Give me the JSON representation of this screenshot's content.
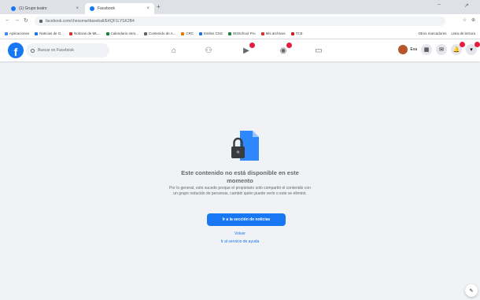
{
  "browser": {
    "tabs": [
      {
        "label": "(1) Grupo teatro",
        "close": "×"
      },
      {
        "label": "Facebook",
        "close": "×"
      }
    ],
    "new_tab": "+",
    "window_controls": [
      "−",
      "↗"
    ],
    "nav": {
      "back": "←",
      "forward": "→",
      "reload": "↻"
    },
    "url": "facebook.com/chessmartbaseball/E4QF1LYSK2B4",
    "addr_icons": [
      "☆",
      "⊕"
    ],
    "bookmarks": [
      {
        "label": "Aplicaciones",
        "color": "#4285f4"
      },
      {
        "label": "Noticias de G...",
        "color": "#1a73e8"
      },
      {
        "label": "Noticias de ML...",
        "color": "#d93025"
      },
      {
        "label": "Calendario sem...",
        "color": "#188038"
      },
      {
        "label": "Contenido de A...",
        "color": "#5f6368"
      },
      {
        "label": "CRC",
        "color": "#e37400"
      },
      {
        "label": "Estilos CSS",
        "color": "#1a73e8"
      },
      {
        "label": "W3School Pro",
        "color": "#188038"
      },
      {
        "label": "Mis archivos",
        "color": "#d93025"
      },
      {
        "label": "TCE",
        "color": "#c5221f"
      }
    ],
    "bookmarks_right": [
      "Otros marcadores",
      "Lista de lectura"
    ]
  },
  "fb": {
    "logo": "f",
    "search_placeholder": "Buscar en Facebook",
    "nav_icons": [
      "home-icon",
      "friends-icon",
      "watch-icon",
      "groups-icon",
      "gaming-icon"
    ],
    "nav_glyphs": [
      "⌂",
      "⚇",
      "▶",
      "◉",
      "▭"
    ],
    "profile_name": "Eva",
    "right_buttons": [
      "▦",
      "✉",
      "🔔",
      "▾"
    ]
  },
  "unavailable": {
    "title": "Este contenido no está disponible en este momento",
    "description": "Por lo general, esto sucede porque el propietario solo compartió el contenido con un grupo reducido de personas, cambió quién puede verlo o este se eliminó.",
    "primary_button": "Ir a la sección de noticias",
    "back_link": "Volver",
    "help_link": "Ir al servicio de ayuda"
  },
  "corner_button": "✎",
  "colors": {
    "brand": "#1877f2",
    "badge": "#e41e3f",
    "background": "#f0f2f5"
  }
}
